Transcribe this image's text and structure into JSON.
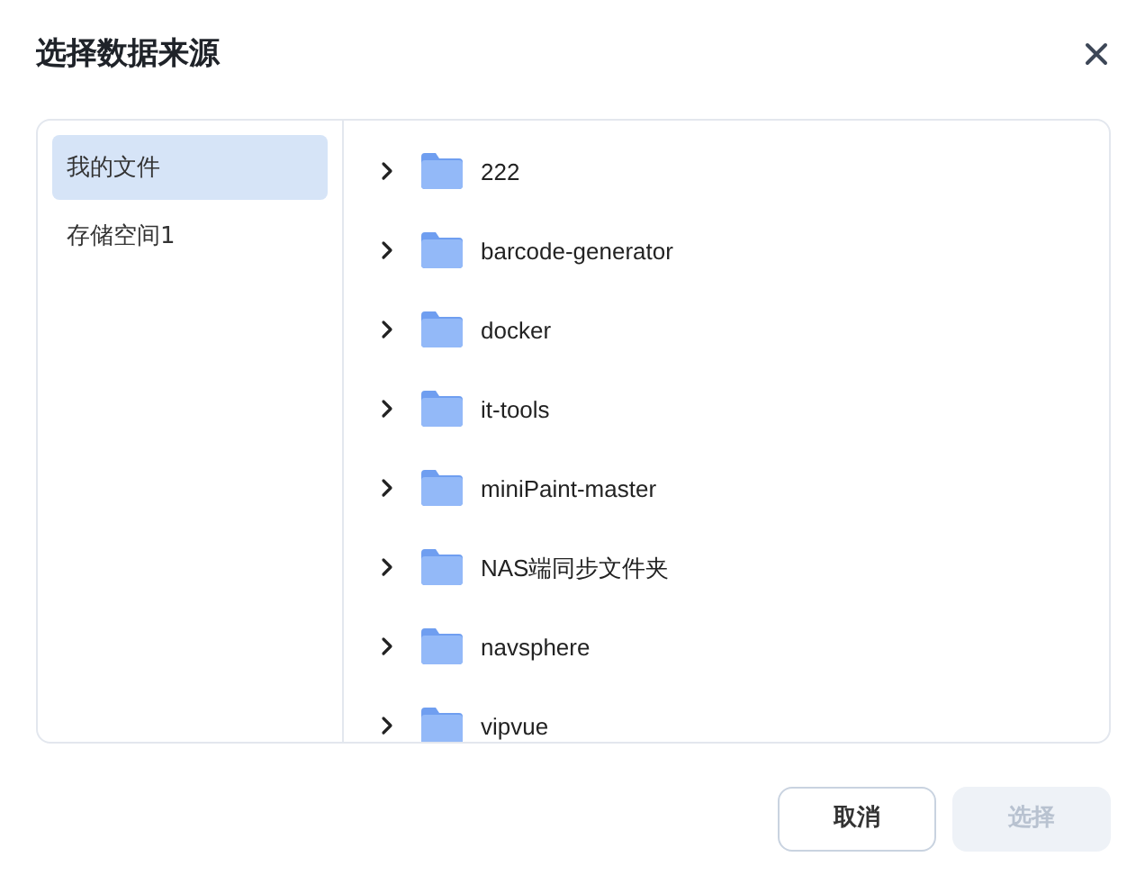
{
  "dialog": {
    "title": "选择数据来源"
  },
  "sidebar": {
    "items": [
      {
        "label": "我的文件",
        "selected": true
      },
      {
        "label": "存储空间1",
        "selected": false
      }
    ]
  },
  "folders": [
    {
      "name": "222",
      "expanded": false
    },
    {
      "name": "barcode-generator",
      "expanded": false
    },
    {
      "name": "docker",
      "expanded": false
    },
    {
      "name": "it-tools",
      "expanded": false
    },
    {
      "name": "miniPaint-master",
      "expanded": false
    },
    {
      "name": "NAS端同步文件夹",
      "expanded": false
    },
    {
      "name": "navsphere",
      "expanded": false
    },
    {
      "name": "vipvue",
      "expanded": false
    }
  ],
  "buttons": [
    {
      "label": "取消",
      "kind": "secondary",
      "disabled": false
    },
    {
      "label": "选择",
      "kind": "primary",
      "disabled": true
    }
  ]
}
